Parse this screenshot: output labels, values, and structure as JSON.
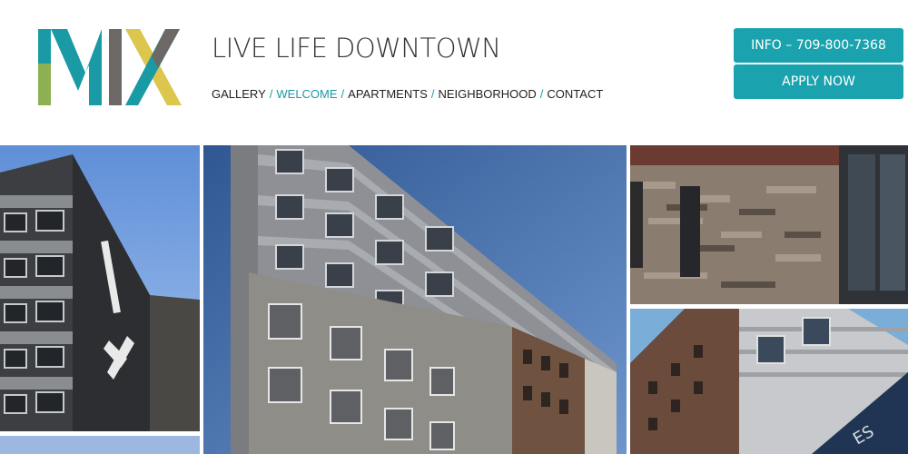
{
  "brand": {
    "logo_text": "MIX",
    "tagline": "LIVE LIFE DOWNTOWN"
  },
  "nav": {
    "items": [
      "GALLERY",
      "WELCOME",
      "APARTMENTS",
      "NEIGHBORHOOD",
      "CONTACT"
    ],
    "active": "WELCOME",
    "separator": "/"
  },
  "buttons": {
    "info": "INFO – 709-800-7368",
    "apply": "APPLY NOW"
  },
  "colors": {
    "accent": "#1aa3ae",
    "logo_teal": "#1a9aa5",
    "logo_green": "#8db152",
    "logo_gray": "#6b6865",
    "logo_yellow": "#dcc64d"
  },
  "gallery": [
    {
      "name": "building-side-photo"
    },
    {
      "name": "building-main-photo"
    },
    {
      "name": "stone-wall-photo"
    },
    {
      "name": "building-corner-photo"
    }
  ]
}
